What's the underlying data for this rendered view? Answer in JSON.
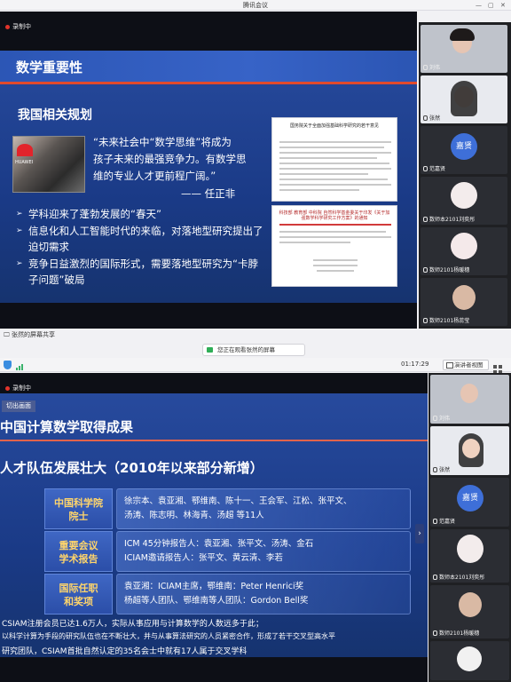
{
  "top": {
    "window_title": "腾讯会议",
    "recording_label": "录制中",
    "share_bar_label": "张然的屏幕共享",
    "slide": {
      "title": "数学重要性",
      "subtitle": "我国相关规划",
      "photo_logo_text": "HUAWEI",
      "quote_line1": "“未来社会中“数学思维”将成为",
      "quote_line2": "孩子未来的最强竞争力。有数学思",
      "quote_line3": "维的专业人才更前程广阔。”",
      "quote_author": "—— 任正非",
      "bullets": [
        "学科迎来了蓬勃发展的“春天”",
        "信息化和人工智能时代的来临，对落地型研究提出了迫切需求",
        "竞争日益激烈的国际形式，需要落地型研究为“卡脖子问题”破局"
      ],
      "doc1_heading": "国务院关于全面加强基础科学研究的若干意见",
      "doc2_heading": "科技部 教育部 中科院 自然科学基金委关于印发《关于加强数学科学研究工作方案》的通知"
    },
    "participants": [
      {
        "name": "刘伟",
        "kind": "video"
      },
      {
        "name": "张然",
        "kind": "video"
      },
      {
        "name": "范嘉贤",
        "kind": "avatar",
        "avatar_text": "嘉贤"
      },
      {
        "name": "数师本2101刘奕彤",
        "kind": "cartoon"
      },
      {
        "name": "数师2101杨暖穗",
        "kind": "cartoon"
      },
      {
        "name": "数师2101杨蕊莹",
        "kind": "video"
      }
    ]
  },
  "bottom": {
    "viewing_label": "您正在观看张然的屏幕",
    "timer": "01:17:29",
    "presenter_view_label": "演讲者视图",
    "recording_label": "录制中",
    "slide": {
      "tag": "切出画面",
      "title": "中国计算数学取得成果",
      "subtitle": "人才队伍发展壮大（2010年以来部分新增）",
      "rows": [
        {
          "label_line1": "中国科学院",
          "label_line2": "院士",
          "value_line1": "徐宗本、袁亚湘、鄂维南、陈十一、王会军、江松、张平文、",
          "value_line2": "汤涛、陈志明、林海青、汤超 等11人"
        },
        {
          "label_line1": "重要会议",
          "label_line2": "学术报告",
          "value_line1": "ICM 45分钟报告人：袁亚湘、张平文、汤涛、金石",
          "value_line2": "ICIAM邀请报告人：张平文、黄云清、李若"
        },
        {
          "label_line1": "国际任职",
          "label_line2": "和奖项",
          "value_line1": "袁亚湘：ICIAM主席，鄂维南：Peter Henrici奖",
          "value_line2": "杨超等人团队、鄂维南等人团队：Gordon Bell奖"
        }
      ],
      "footer_line1": "CSIAM注册会员已达1.6万人，实际从事应用与计算数学的人数远多于此；",
      "footer_line2": "以科学计算为手段的研究队伍也在不断壮大，并与从事算法研究的人员紧密合作，形成了若干交叉型高水平",
      "footer_line3": "研究团队，CSIAM首批自然认定的35名会士中就有17人属于交叉学科"
    },
    "participants": [
      {
        "name": "刘伟",
        "kind": "video"
      },
      {
        "name": "张然",
        "kind": "video"
      },
      {
        "name": "范嘉贤",
        "kind": "avatar",
        "avatar_text": "嘉贤"
      },
      {
        "name": "数师本2101刘奕彤",
        "kind": "cartoon"
      },
      {
        "name": "数师2101杨暖穗",
        "kind": "video"
      }
    ]
  },
  "colors": {
    "slide_blue": "#1c3d8c",
    "accent_red": "#e24a2c",
    "label_gold": "#ffd56b"
  }
}
